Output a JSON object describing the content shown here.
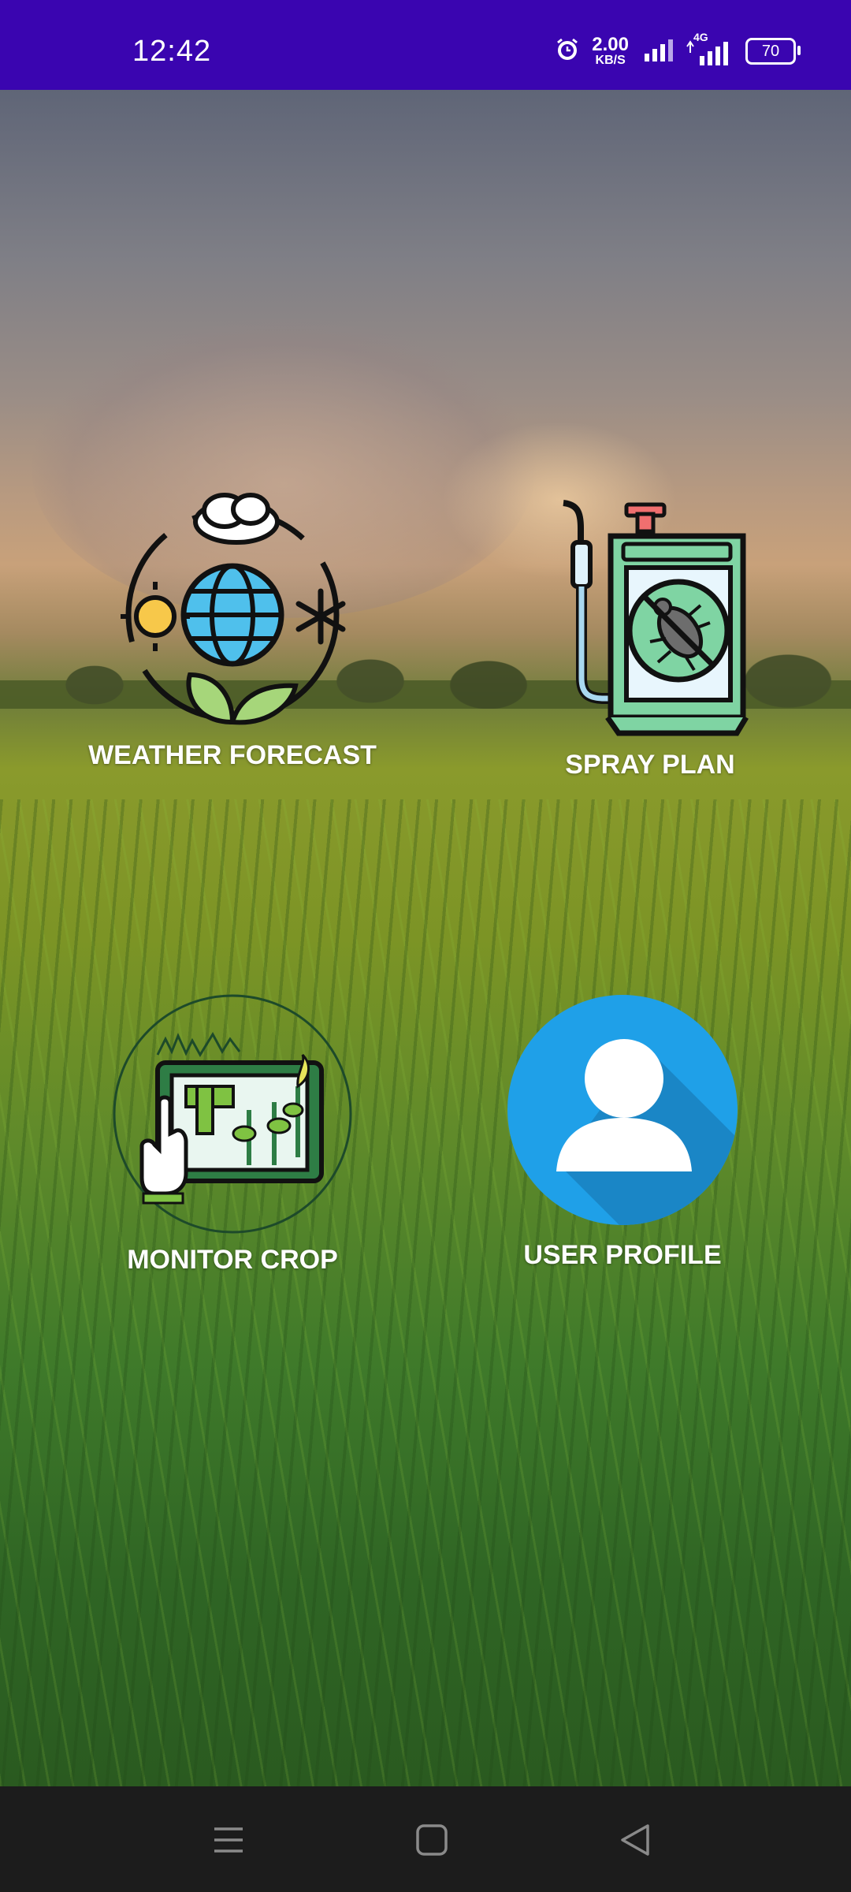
{
  "status_bar": {
    "time": "12:42",
    "speed_value": "2.00",
    "speed_unit": "KB/S",
    "network": "4G",
    "battery": "70",
    "icons": [
      "alarm-icon",
      "signal-icon",
      "network-4g-icon",
      "battery-icon"
    ]
  },
  "tiles": [
    {
      "label": "WEATHER FORECAST",
      "icon": "weather-globe-icon"
    },
    {
      "label": "SPRAY PLAN",
      "icon": "sprayer-icon"
    },
    {
      "label": "MONITOR CROP",
      "icon": "crop-monitor-icon"
    },
    {
      "label": "USER PROFILE",
      "icon": "user-avatar-icon"
    }
  ],
  "nav_bar": {
    "icons": [
      "menu-icon",
      "home-icon",
      "back-icon"
    ]
  },
  "colors": {
    "status_bar": "#3a05b0",
    "nav_bar": "#1c1c1c",
    "profile_blue": "#1fa0e8",
    "spray_green": "#7fd4a3"
  }
}
